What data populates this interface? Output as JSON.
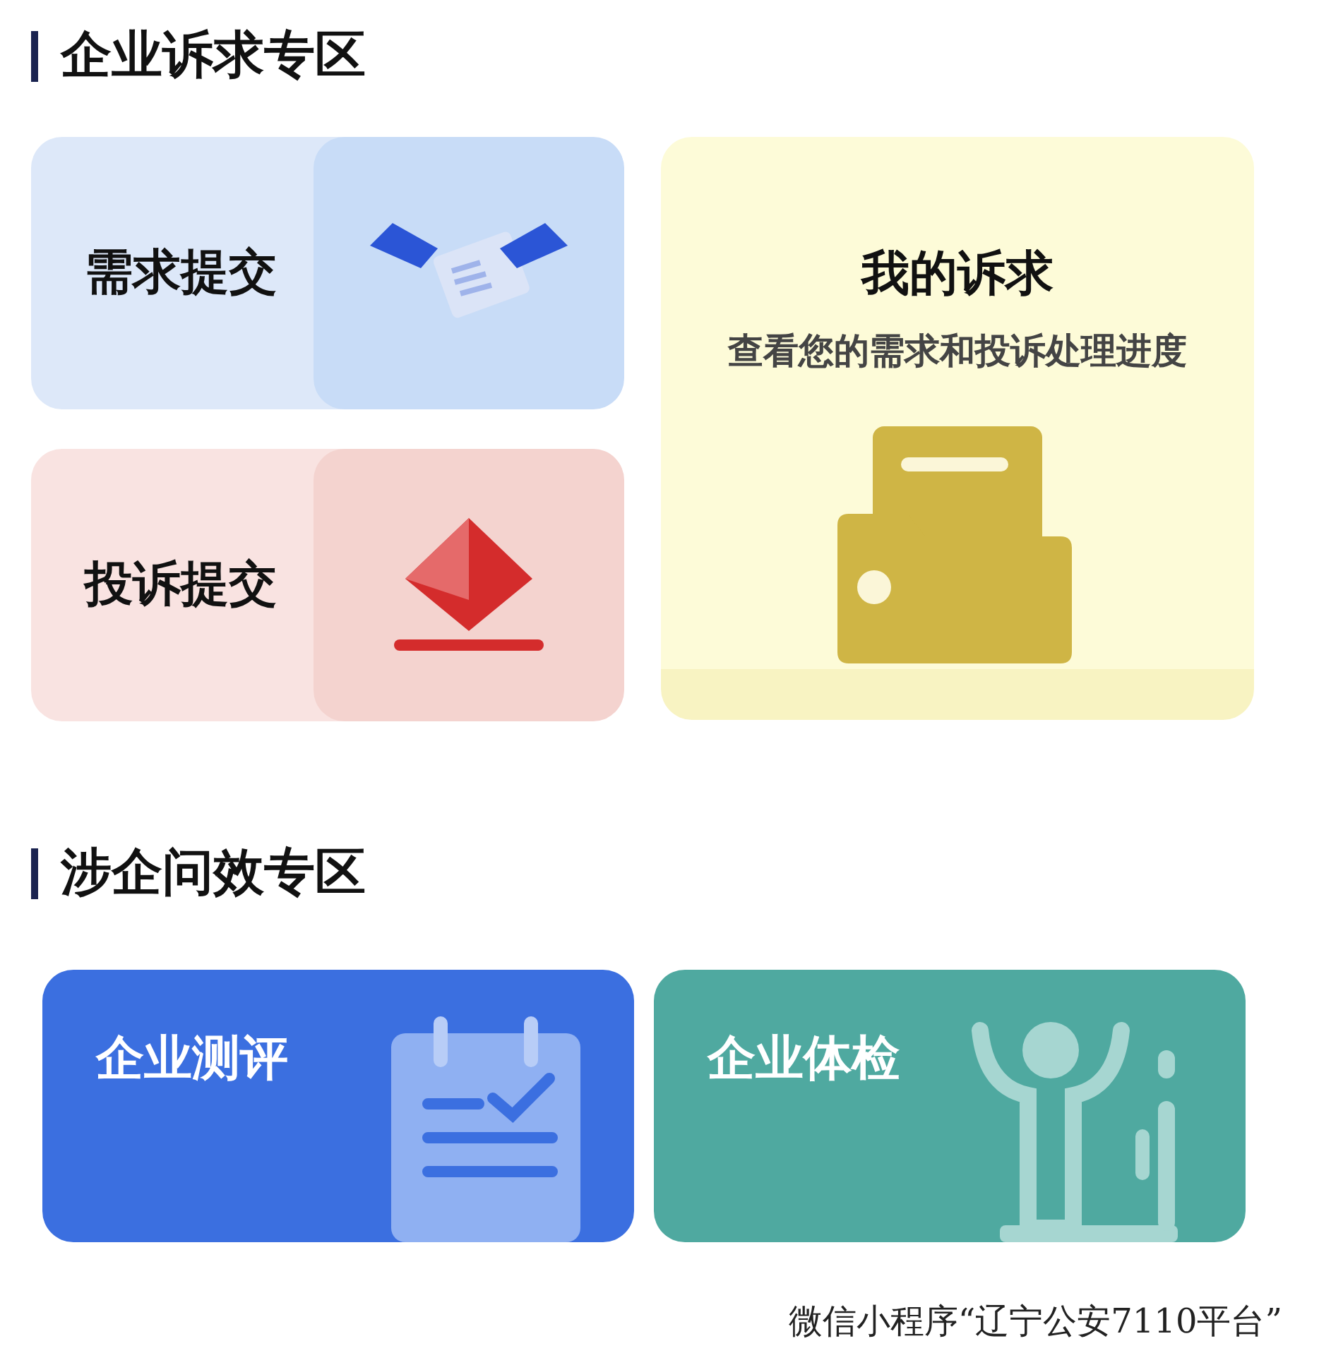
{
  "sections": [
    {
      "title": "企业诉求专区",
      "cards": [
        {
          "title": "需求提交",
          "kind": "demand"
        },
        {
          "title": "投诉提交",
          "kind": "complaint"
        },
        {
          "title": "我的诉求",
          "subtitle": "查看您的需求和投诉处理进度",
          "kind": "mine"
        }
      ]
    },
    {
      "title": "涉企问效专区",
      "cards": [
        {
          "title": "企业测评",
          "kind": "evaluation"
        },
        {
          "title": "企业体检",
          "kind": "checkup"
        }
      ]
    }
  ],
  "source_caption": "微信小程序“辽宁公安7110平台”"
}
